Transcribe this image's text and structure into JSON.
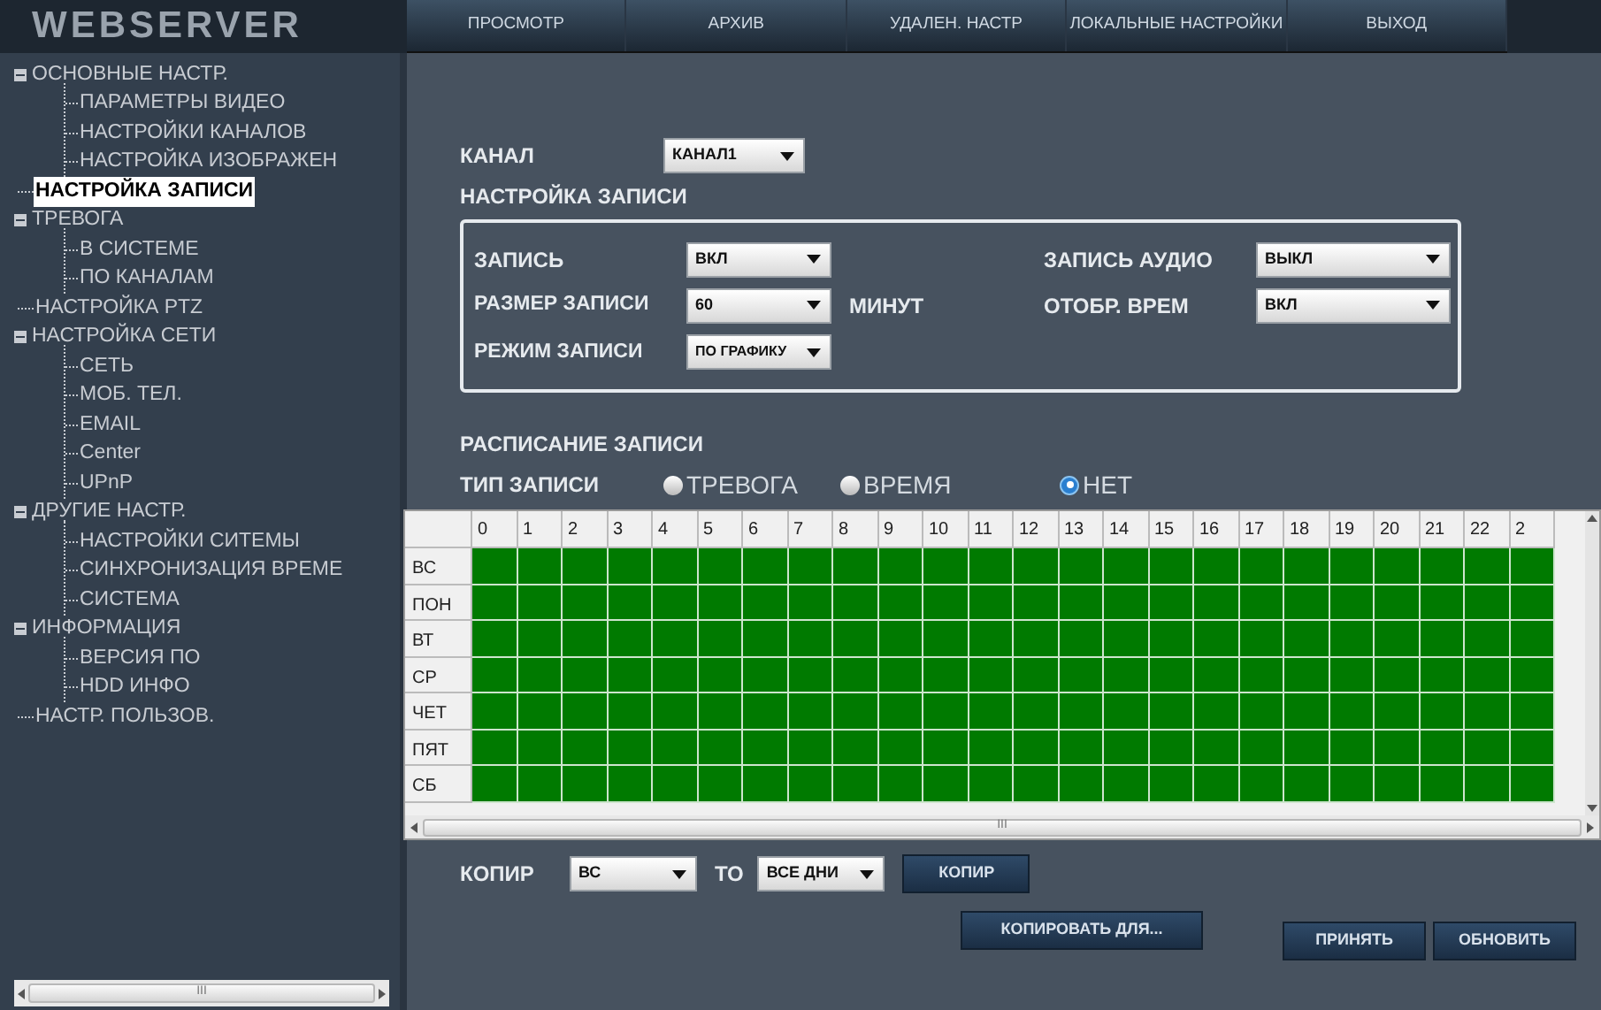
{
  "logo": "WEBSERVER",
  "top_menu": [
    {
      "label": "ПРОСМОТР",
      "selected": false
    },
    {
      "label": "АРХИВ",
      "selected": false
    },
    {
      "label": "УДАЛЕН. НАСТР",
      "selected": false
    },
    {
      "label": "ЛОКАЛЬНЫЕ НАСТРОЙКИ",
      "selected": false
    },
    {
      "label": "ВЫХОД",
      "selected": false
    }
  ],
  "sidebar": {
    "items": [
      {
        "label": "ОСНОВНЫЕ НАСТР.",
        "selected": false,
        "expanded": true,
        "children": [
          {
            "label": "ПАРАМЕТРЫ ВИДЕО",
            "selected": false
          },
          {
            "label": "НАСТРОЙКИ КАНАЛОВ",
            "selected": false
          },
          {
            "label": "НАСТРОЙКА ИЗОБРАЖЕН",
            "selected": false
          }
        ]
      },
      {
        "label": "НАСТРОЙКА ЗАПИСИ",
        "selected": true
      },
      {
        "label": "ТРЕВОГА",
        "selected": false,
        "expanded": true,
        "children": [
          {
            "label": "В СИСТЕМЕ",
            "selected": false
          },
          {
            "label": "ПО КАНАЛАМ",
            "selected": false
          }
        ]
      },
      {
        "label": "НАСТРОЙКА PTZ",
        "selected": false
      },
      {
        "label": "НАСТРОЙКА СЕТИ",
        "selected": false,
        "expanded": true,
        "children": [
          {
            "label": "СЕТЬ",
            "selected": false
          },
          {
            "label": "МОБ. ТЕЛ.",
            "selected": false
          },
          {
            "label": "EMAIL",
            "selected": false
          },
          {
            "label": "Center",
            "selected": false
          },
          {
            "label": "UPnP",
            "selected": false
          }
        ]
      },
      {
        "label": "ДРУГИЕ НАСТР.",
        "selected": false,
        "expanded": true,
        "children": [
          {
            "label": "НАСТРОЙКИ СИТЕМЫ",
            "selected": false
          },
          {
            "label": "СИНХРОНИЗАЦИЯ ВРЕМЕ",
            "selected": false
          },
          {
            "label": "СИСТЕМА",
            "selected": false
          }
        ]
      },
      {
        "label": "ИНФОРМАЦИЯ",
        "selected": false,
        "expanded": true,
        "children": [
          {
            "label": "ВЕРСИЯ ПО",
            "selected": false
          },
          {
            "label": "HDD ИНФО",
            "selected": false
          }
        ]
      },
      {
        "label": "НАСТР. ПОЛЬЗОВ.",
        "selected": false
      }
    ],
    "scroll_grip": "III"
  },
  "channel": {
    "label": "КАНАЛ",
    "value": "КАНАЛ1"
  },
  "record_settings": {
    "title": "НАСТРОЙКА ЗАПИСИ",
    "record": {
      "label": "ЗАПИСЬ",
      "value": "ВКЛ"
    },
    "audio": {
      "label": "ЗАПИСЬ АУДИО",
      "value": "ВЫКЛ"
    },
    "size": {
      "label": "РАЗМЕР ЗАПИСИ",
      "value": "60",
      "unit": "МИНУТ"
    },
    "show_time": {
      "label": "ОТОБР. ВРЕМ",
      "value": "ВКЛ"
    },
    "mode": {
      "label": "РЕЖИМ ЗАПИСИ",
      "value": "ПО ГРАФИКУ"
    }
  },
  "schedule": {
    "title": "РАСПИСАНИЕ ЗАПИСИ",
    "type_label": "ТИП ЗАПИСИ",
    "types": [
      {
        "label": "ТРЕВОГА",
        "selected": false
      },
      {
        "label": "ВРЕМЯ",
        "selected": false
      },
      {
        "label": "НЕТ",
        "selected": true
      }
    ],
    "hours": [
      "0",
      "1",
      "2",
      "3",
      "4",
      "5",
      "6",
      "7",
      "8",
      "9",
      "10",
      "11",
      "12",
      "13",
      "14",
      "15",
      "16",
      "17",
      "18",
      "19",
      "20",
      "21",
      "22",
      "2"
    ],
    "rows": [
      {
        "day": "ВС",
        "filled": true
      },
      {
        "day": "ПОН",
        "filled": true
      },
      {
        "day": "ВТ",
        "filled": true
      },
      {
        "day": "СР",
        "filled": true
      },
      {
        "day": "ЧЕТ",
        "filled": true
      },
      {
        "day": "ПЯТ",
        "filled": true
      },
      {
        "day": "СБ",
        "filled": true
      }
    ],
    "scroll_grip": "III"
  },
  "copy": {
    "label": "КОПИР",
    "from": "ВС",
    "to_label": "ТО",
    "to": "ВСЕ ДНИ",
    "button": "КОПИР"
  },
  "buttons": {
    "copy_for": "КОПИРОВАТЬ ДЛЯ...",
    "apply": "ПРИНЯТЬ",
    "refresh": "ОБНОВИТЬ"
  }
}
